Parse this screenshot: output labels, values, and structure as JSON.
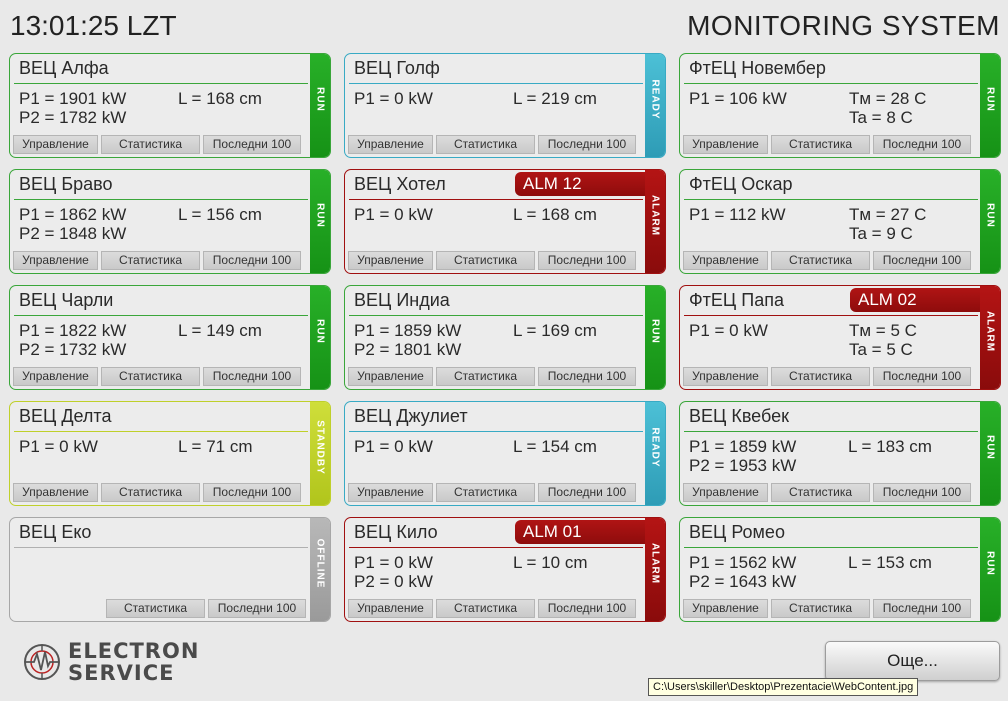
{
  "header": {
    "clock": "13:01:25 LZT",
    "title": "MONITORING SYSTEM"
  },
  "buttons": {
    "control": "Управление",
    "stats": "Статистика",
    "last100": "Последни 100"
  },
  "status_colors": {
    "RUN": "#169216",
    "ALARM": "#8e0c0c",
    "READY": "#2e9cb6",
    "STANDBY": "#b1c51c",
    "OFFLINE": "#9a9a9a"
  },
  "cards": [
    {
      "name": "ВЕЦ Алфа",
      "status": "RUN",
      "p1": "P1 = 1901 kW",
      "p2": "P2 = 1782 kW",
      "level": "L = 168 cm"
    },
    {
      "name": "ВЕЦ Голф",
      "status": "READY",
      "p1": "P1 =     0 kW",
      "level": "L = 219 cm"
    },
    {
      "name": "ФтЕЦ Новембер",
      "status": "RUN",
      "p1": "P1 =  106 kW",
      "tm": "Tм = 28 C",
      "ta": "Ta =   8 C"
    },
    {
      "name": "ВЕЦ Браво",
      "status": "RUN",
      "p1": "P1 = 1862 kW",
      "p2": "P2 = 1848 kW",
      "level": "L = 156 cm"
    },
    {
      "name": "ВЕЦ Хотел",
      "status": "ALARM",
      "alarm": "ALM 12",
      "p1": "P1 =     0 kW",
      "level": "L = 168 cm"
    },
    {
      "name": "ФтЕЦ Оскар",
      "status": "RUN",
      "p1": "P1 =  112 kW",
      "tm": "Tм = 27 C",
      "ta": "Ta =   9 C"
    },
    {
      "name": "ВЕЦ Чарли",
      "status": "RUN",
      "p1": "P1 = 1822 kW",
      "p2": "P2 = 1732 kW",
      "level": "L = 149 cm"
    },
    {
      "name": "ВЕЦ Индиа",
      "status": "RUN",
      "p1": "P1 = 1859 kW",
      "p2": "P2 = 1801 kW",
      "level": "L = 169 cm"
    },
    {
      "name": "ФтЕЦ Папа",
      "status": "ALARM",
      "alarm": "ALM 02",
      "p1": "P1 =     0 kW",
      "tm": "Tм =   5 C",
      "ta": "Ta =   5 C"
    },
    {
      "name": "ВЕЦ Делта",
      "status": "STANDBY",
      "p1": "P1 =     0 kW",
      "level": "L = 71 cm"
    },
    {
      "name": "ВЕЦ Джулиет",
      "status": "READY",
      "p1": "P1 =     0 kW",
      "level": "L = 154 cm"
    },
    {
      "name": "ВЕЦ Квебек",
      "status": "RUN",
      "p1": "P1 = 1859 kW",
      "p2": "P2 = 1953 kW",
      "level": "L = 183 cm"
    },
    {
      "name": "ВЕЦ Еко",
      "status": "OFFLINE",
      "no_control": true
    },
    {
      "name": "ВЕЦ Кило",
      "status": "ALARM",
      "alarm": "ALM 01",
      "p1": "P1 =     0 kW",
      "p2": "P2 =     0 kW",
      "level": "L = 10 cm"
    },
    {
      "name": "ВЕЦ Ромео",
      "status": "RUN",
      "p1": "P1 = 1562 kW",
      "p2": "P2 = 1643 kW",
      "level": "L = 153 cm"
    }
  ],
  "footer": {
    "logo_line1": "ELECTRON",
    "logo_line2": "SERVICE",
    "more_button": "Още...",
    "tooltip": "C:\\Users\\skiller\\Desktop\\Prezentacie\\WebContent.jpg"
  }
}
